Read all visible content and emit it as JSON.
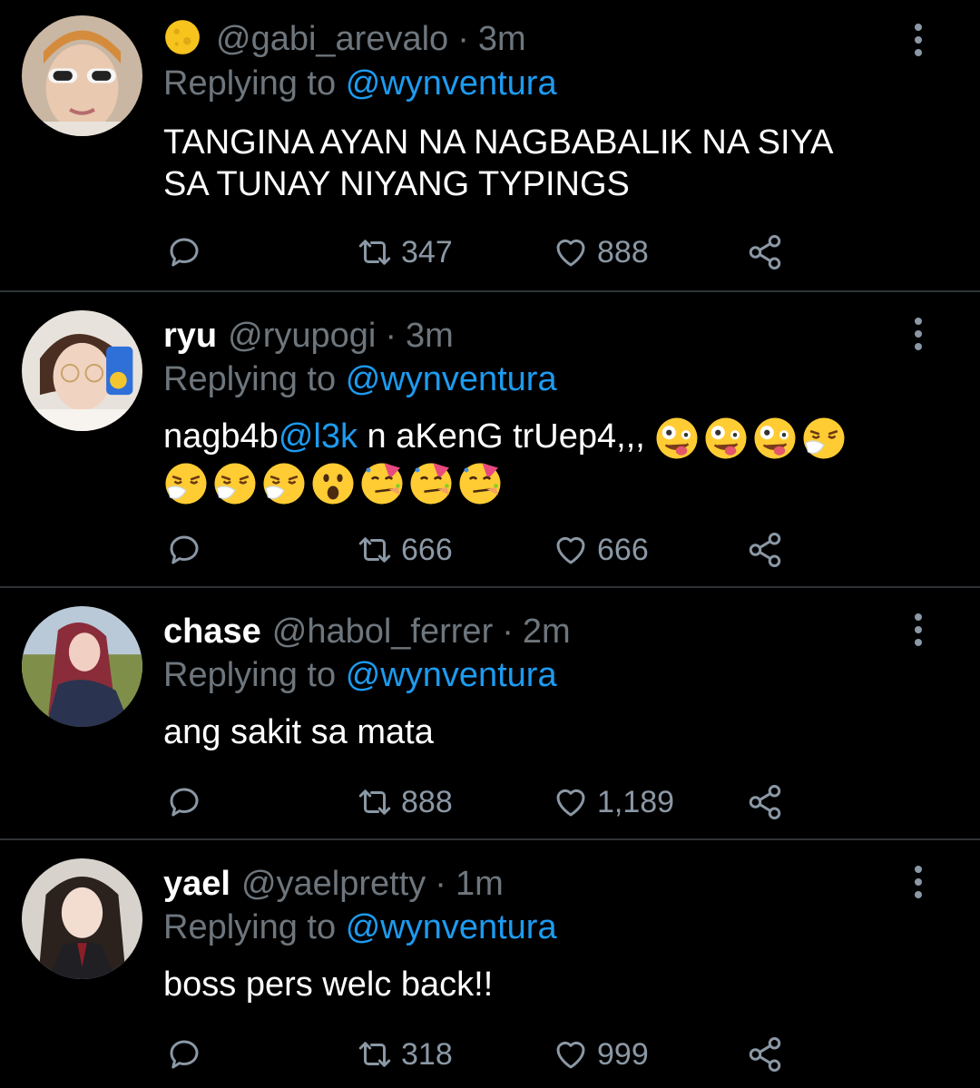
{
  "tweets": [
    {
      "name": "",
      "badge_icon": "crescent-moon-emoji",
      "handle": "@gabi_arevalo",
      "time": "3m",
      "replying_prefix": "Replying to",
      "replying_to": "@wynventura",
      "text_lines": [
        "TANGINA AYAN NA NAGBABALIK NA SIYA",
        "SA TUNAY NIYANG TYPINGS"
      ],
      "retweets": "347",
      "likes": "888"
    },
    {
      "name": "ryu",
      "handle": "@ryupogi",
      "time": "3m",
      "replying_prefix": "Replying to",
      "replying_to": "@wynventura",
      "text_before": "nagb4b",
      "text_mention": "@l3k",
      "text_after": " n aKenG trUep4,,, ",
      "emojis_line1": [
        "zany-face",
        "zany-face",
        "zany-face",
        "sneezing-face"
      ],
      "emojis_line2": [
        "sneezing-face",
        "sneezing-face",
        "sneezing-face",
        "astonished-face",
        "partying-face",
        "partying-face",
        "partying-face"
      ],
      "retweets": "666",
      "likes": "666"
    },
    {
      "name": "chase",
      "handle": "@habol_ferrer",
      "time": "2m",
      "replying_prefix": "Replying to",
      "replying_to": "@wynventura",
      "text": "ang sakit sa mata",
      "retweets": "888",
      "likes": "1,189"
    },
    {
      "name": "yael",
      "handle": "@yaelpretty",
      "time": "1m",
      "replying_prefix": "Replying to",
      "replying_to": "@wynventura",
      "text": "boss pers welc back!!",
      "retweets": "318",
      "likes": "999"
    }
  ],
  "icons": {
    "reply": "reply-icon",
    "retweet": "retweet-icon",
    "like": "heart-icon",
    "share": "share-icon",
    "more": "more-vertical-icon"
  },
  "colors": {
    "background": "#000000",
    "secondary_text": "#6e767d",
    "mention": "#1d9bf0",
    "divider": "#2f3336"
  }
}
